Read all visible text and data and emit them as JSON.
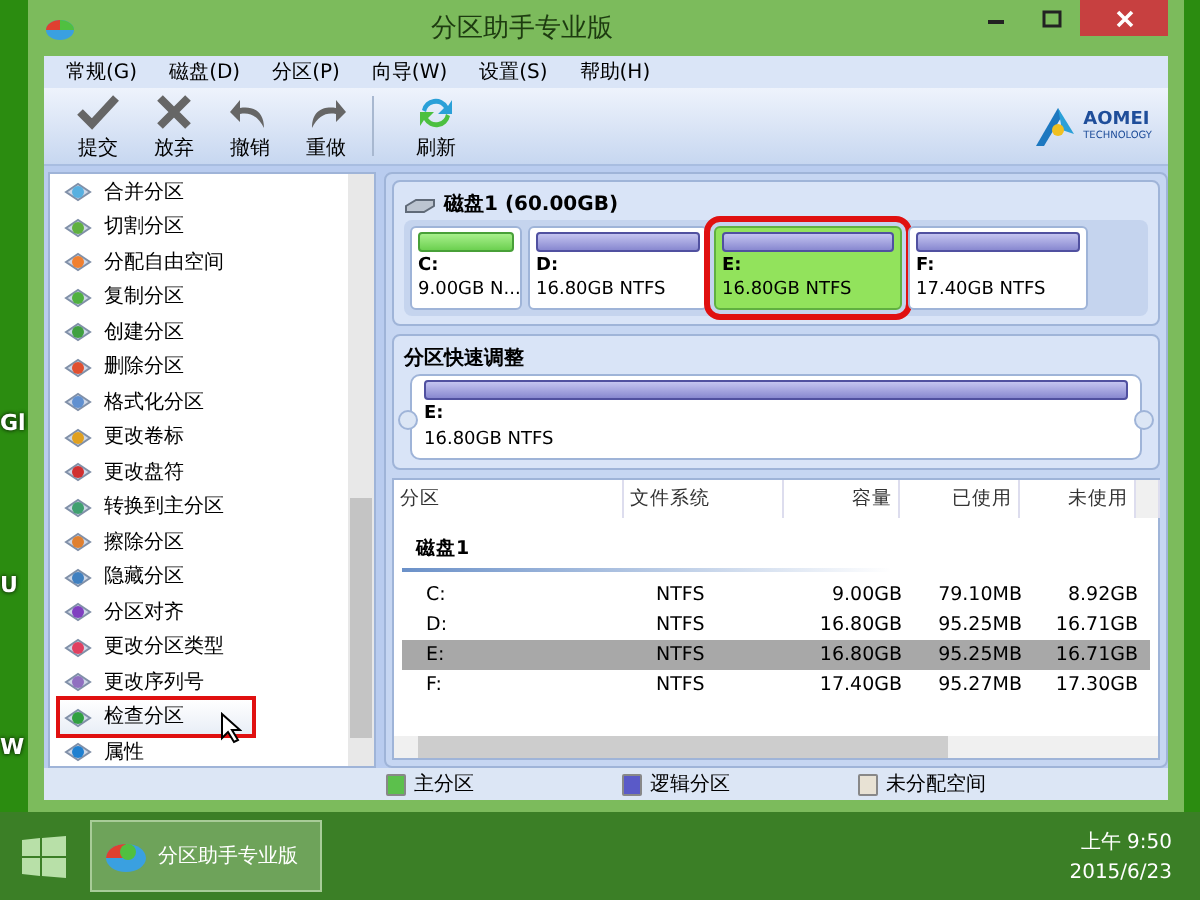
{
  "desktop_labels": [
    "Gl",
    "U",
    "W"
  ],
  "window": {
    "title": "分区助手专业版"
  },
  "menu": [
    "常规(G)",
    "磁盘(D)",
    "分区(P)",
    "向导(W)",
    "设置(S)",
    "帮助(H)"
  ],
  "toolbar": [
    {
      "label": "提交",
      "kind": "check"
    },
    {
      "label": "放弃",
      "kind": "cross"
    },
    {
      "label": "撤销",
      "kind": "undo"
    },
    {
      "label": "重做",
      "kind": "redo"
    },
    {
      "label": "刷新",
      "kind": "refresh"
    }
  ],
  "logo": {
    "name": "AOMEI",
    "tagline": "TECHNOLOGY"
  },
  "sidebar": {
    "items": [
      {
        "label": "合并分区",
        "selected": false
      },
      {
        "label": "切割分区",
        "selected": false
      },
      {
        "label": "分配自由空间",
        "selected": false
      },
      {
        "label": "复制分区",
        "selected": false
      },
      {
        "label": "创建分区",
        "selected": false
      },
      {
        "label": "删除分区",
        "selected": false
      },
      {
        "label": "格式化分区",
        "selected": false
      },
      {
        "label": "更改卷标",
        "selected": false
      },
      {
        "label": "更改盘符",
        "selected": false
      },
      {
        "label": "转换到主分区",
        "selected": false
      },
      {
        "label": "擦除分区",
        "selected": false
      },
      {
        "label": "隐藏分区",
        "selected": false
      },
      {
        "label": "分区对齐",
        "selected": false
      },
      {
        "label": "更改分区类型",
        "selected": false
      },
      {
        "label": "更改序列号",
        "selected": false
      },
      {
        "label": "检查分区",
        "selected": true
      },
      {
        "label": "属性",
        "selected": false
      }
    ]
  },
  "disk": {
    "title": "磁盘1 (60.00GB)",
    "partitions": [
      {
        "name": "C:",
        "info": "9.00GB N...",
        "kind": "primary",
        "selected": false
      },
      {
        "name": "D:",
        "info": "16.80GB NTFS",
        "kind": "logical",
        "selected": false
      },
      {
        "name": "E:",
        "info": "16.80GB NTFS",
        "kind": "logical",
        "selected": true
      },
      {
        "name": "F:",
        "info": "17.40GB NTFS",
        "kind": "logical",
        "selected": false
      }
    ]
  },
  "quick_resize": {
    "title": "分区快速调整",
    "name": "E:",
    "info": "16.80GB NTFS"
  },
  "table": {
    "columns": [
      "分区",
      "文件系统",
      "容量",
      "已使用",
      "未使用"
    ],
    "groups": [
      {
        "name": "磁盘1",
        "rows": [
          {
            "cells": [
              "C:",
              "NTFS",
              "9.00GB",
              "79.10MB",
              "8.92GB"
            ],
            "selected": false
          },
          {
            "cells": [
              "D:",
              "NTFS",
              "16.80GB",
              "95.25MB",
              "16.71GB"
            ],
            "selected": false
          },
          {
            "cells": [
              "E:",
              "NTFS",
              "16.80GB",
              "95.25MB",
              "16.71GB"
            ],
            "selected": true
          },
          {
            "cells": [
              "F:",
              "NTFS",
              "17.40GB",
              "95.27MB",
              "17.30GB"
            ],
            "selected": false
          }
        ]
      }
    ]
  },
  "legend": [
    {
      "label": "主分区",
      "color": "#5cc04c"
    },
    {
      "label": "逻辑分区",
      "color": "#5a5ac8"
    },
    {
      "label": "未分配空间",
      "color": "#e8e2d4"
    }
  ],
  "taskbar": {
    "app": "分区助手专业版",
    "time": "上午 9:50",
    "date": "2015/6/23"
  }
}
